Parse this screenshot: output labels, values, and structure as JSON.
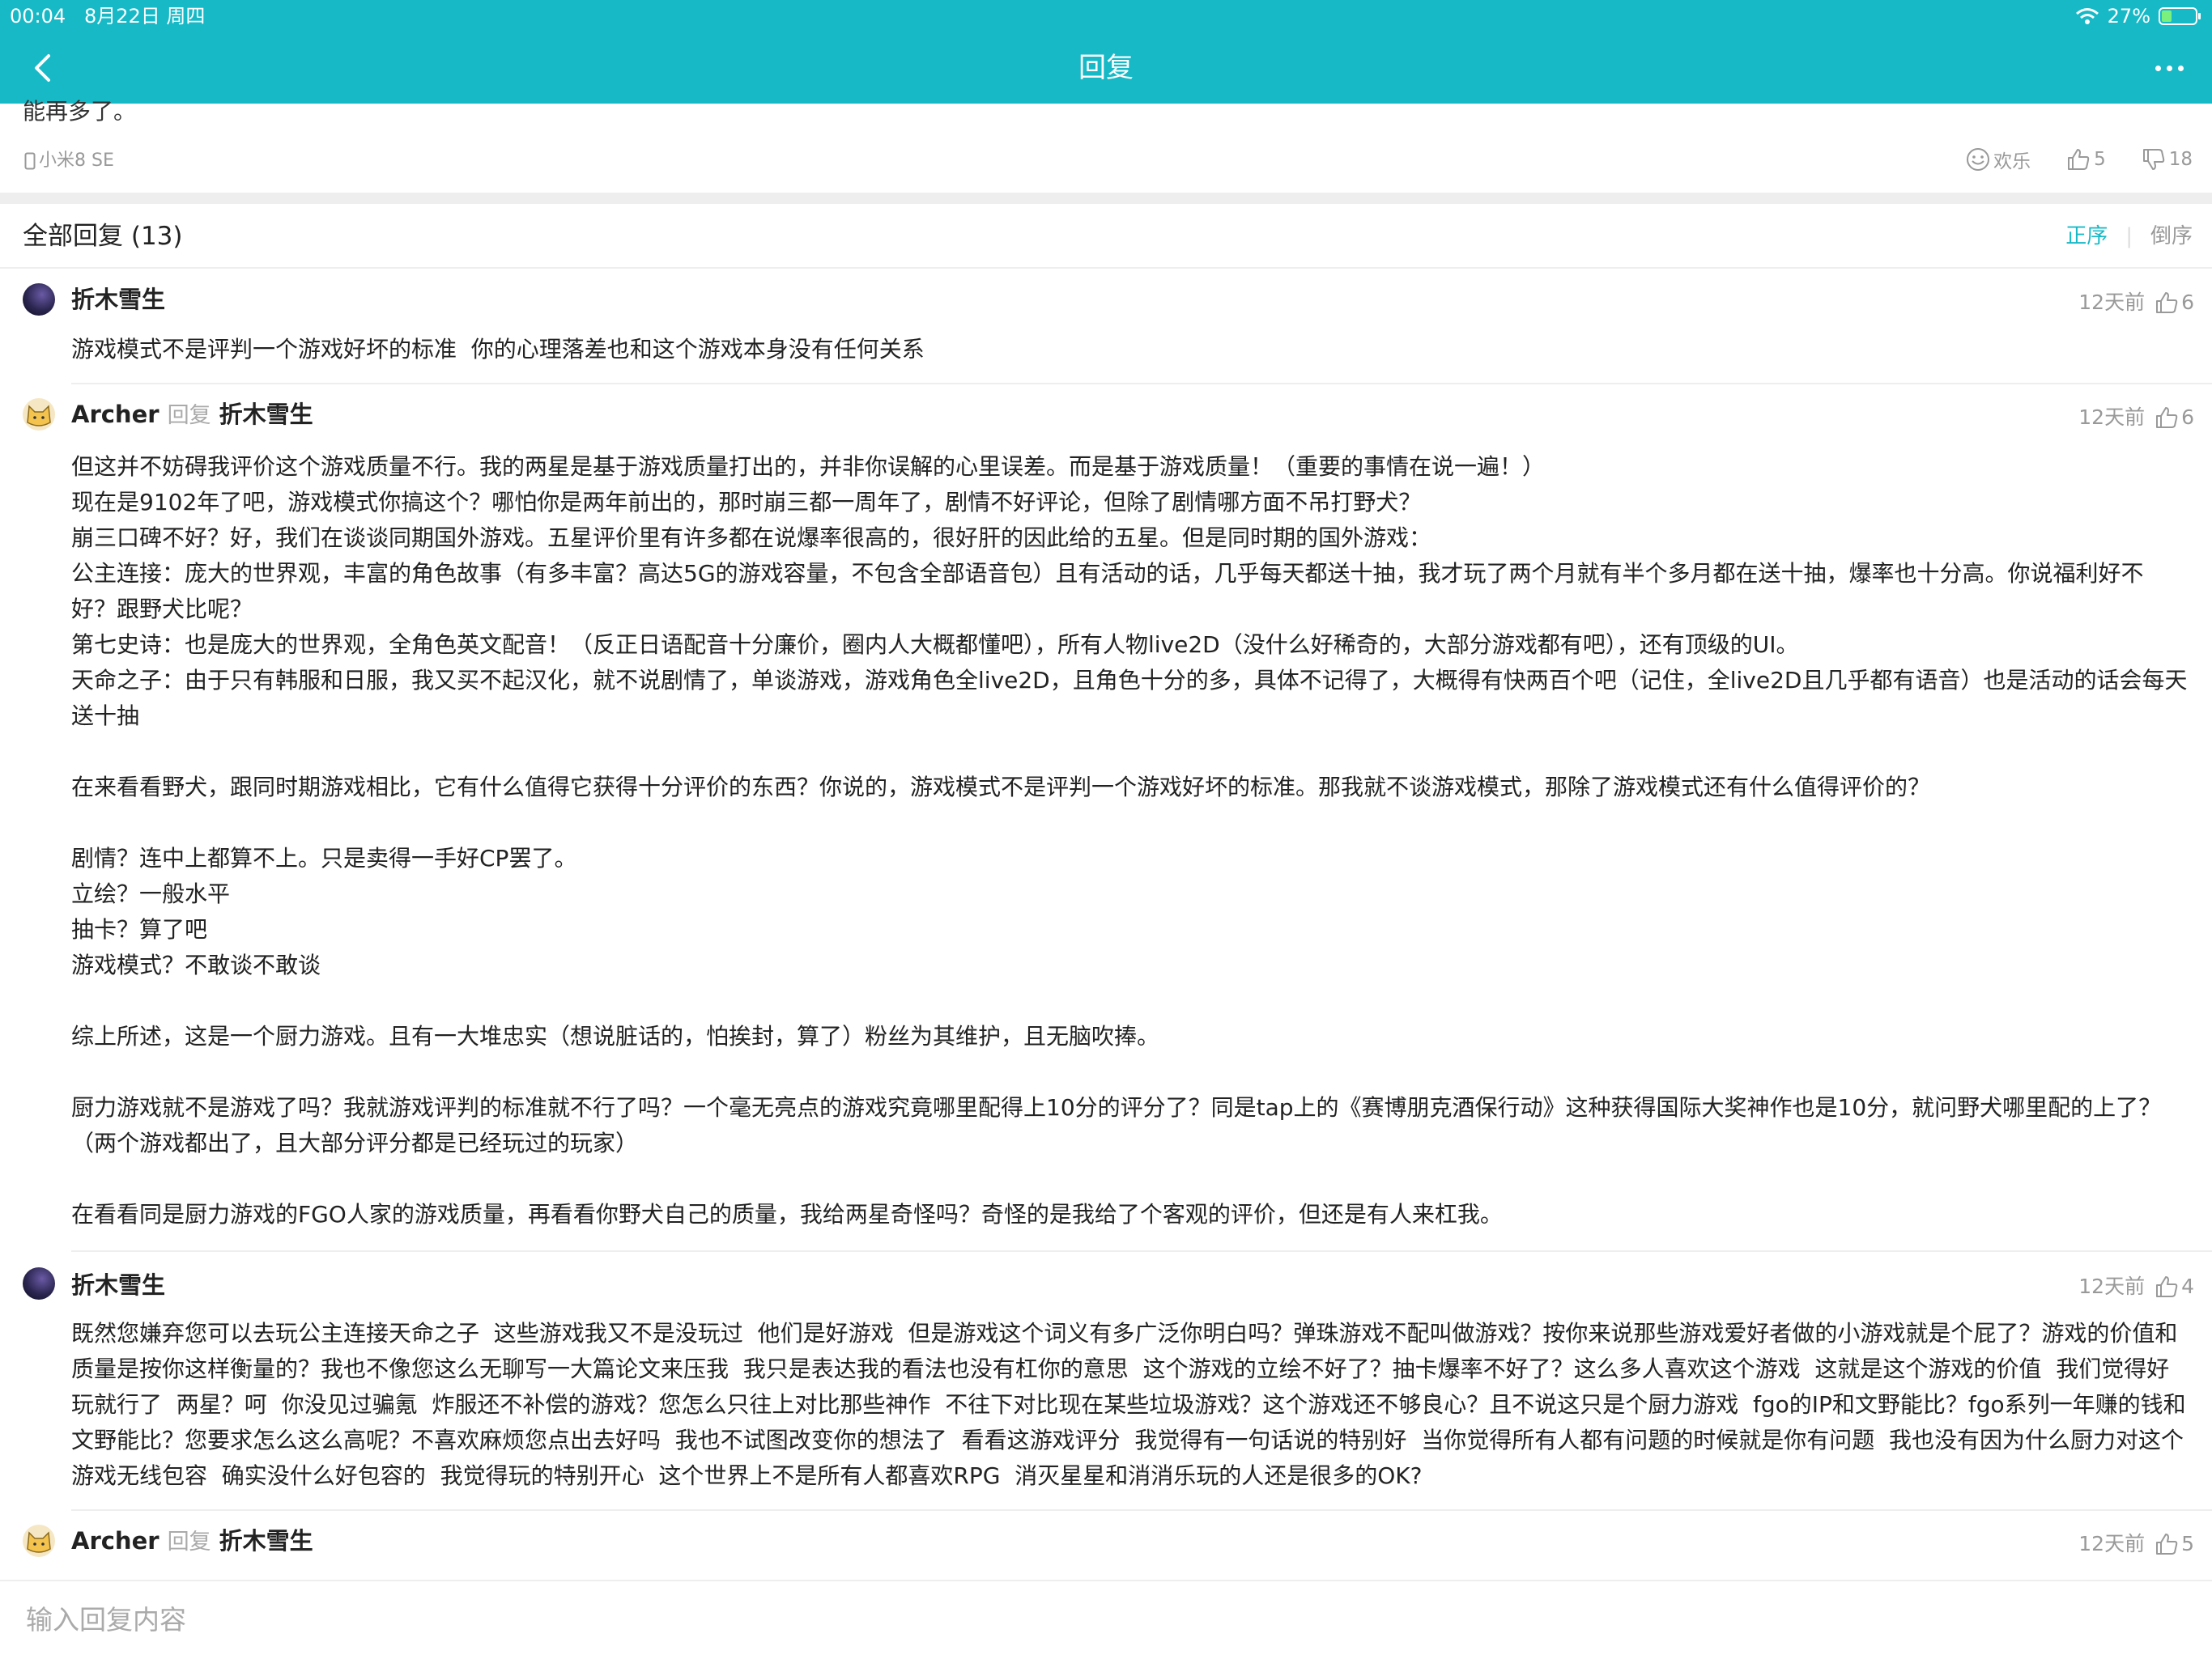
{
  "status_bar": {
    "time": "00:04",
    "date": "8月22日 周四",
    "battery": "27%"
  },
  "header": {
    "title": "回复",
    "accent_color": "#17b9c7"
  },
  "post": {
    "clipped_text": "能再多了。",
    "device": "小米8 SE",
    "mood_label": "欢乐",
    "likes": "5",
    "dislikes": "18"
  },
  "replies_section": {
    "title": "全部回复 (13)",
    "sort_asc": "正序",
    "sort_desc": "倒序"
  },
  "replies": [
    {
      "user": "折木雪生",
      "time": "12天前",
      "likes": "6",
      "text": "游戏模式不是评判一个游戏好坏的标准  你的心理落差也和这个游戏本身没有任何关系"
    },
    {
      "user": "Archer",
      "reply_word": "回复",
      "reply_to": "折木雪生",
      "time": "12天前",
      "likes": "6",
      "text": "但这并不妨碍我评价这个游戏质量不行。我的两星是基于游戏质量打出的，并非你误解的心里误差。而是基于游戏质量！（重要的事情在说一遍！）\n现在是9102年了吧，游戏模式你搞这个？哪怕你是两年前出的，那时崩三都一周年了，剧情不好评论，但除了剧情哪方面不吊打野犬？\n崩三口碑不好？好，我们在谈谈同期国外游戏。五星评价里有许多都在说爆率很高的，很好肝的因此给的五星。但是同时期的国外游戏：\n公主连接：庞大的世界观，丰富的角色故事（有多丰富？高达5G的游戏容量，不包含全部语音包）且有活动的话，几乎每天都送十抽，我才玩了两个月就有半个多月都在送十抽，爆率也十分高。你说福利好不好？跟野犬比呢？\n第七史诗：也是庞大的世界观，全角色英文配音！（反正日语配音十分廉价，圈内人大概都懂吧），所有人物live2D（没什么好稀奇的，大部分游戏都有吧），还有顶级的UI。\n天命之子：由于只有韩服和日服，我又买不起汉化，就不说剧情了，单谈游戏，游戏角色全live2D，且角色十分的多，具体不记得了，大概得有快两百个吧（记住，全live2D且几乎都有语音）也是活动的话会每天送十抽\n\n在来看看野犬，跟同时期游戏相比，它有什么值得它获得十分评价的东西？你说的，游戏模式不是评判一个游戏好坏的标准。那我就不谈游戏模式，那除了游戏模式还有什么值得评价的？\n\n剧情？连中上都算不上。只是卖得一手好CP罢了。\n立绘？一般水平\n抽卡？算了吧\n游戏模式？不敢谈不敢谈\n\n综上所述，这是一个厨力游戏。且有一大堆忠实（想说脏话的，怕挨封，算了）粉丝为其维护，且无脑吹捧。\n\n厨力游戏就不是游戏了吗？我就游戏评判的标准就不行了吗？一个毫无亮点的游戏究竟哪里配得上10分的评分了？同是tap上的《赛博朋克酒保行动》这种获得国际大奖神作也是10分，就问野犬哪里配的上了？（两个游戏都出了，且大部分评分都是已经玩过的玩家）\n\n在看看同是厨力游戏的FGO人家的游戏质量，再看看你野犬自己的质量，我给两星奇怪吗？奇怪的是我给了个客观的评价，但还是有人来杠我。"
    },
    {
      "user": "折木雪生",
      "time": "12天前",
      "likes": "4",
      "text": "既然您嫌弃您可以去玩公主连接天命之子  这些游戏我又不是没玩过  他们是好游戏  但是游戏这个词义有多广泛你明白吗？弹珠游戏不配叫做游戏？按你来说那些游戏爱好者做的小游戏就是个屁了？游戏的价值和质量是按你这样衡量的？我也不像您这么无聊写一大篇论文来压我  我只是表达我的看法也没有杠你的意思  这个游戏的立绘不好了？抽卡爆率不好了？这么多人喜欢这个游戏  这就是这个游戏的价值  我们觉得好玩就行了  两星？呵  你没见过骗氪  炸服还不补偿的游戏？您怎么只往上对比那些神作  不往下对比现在某些垃圾游戏？这个游戏还不够良心？且不说这只是个厨力游戏  fgo的IP和文野能比？fgo系列一年赚的钱和文野能比？您要求怎么这么高呢？不喜欢麻烦您点出去好吗  我也不试图改变你的想法了  看看这游戏评分  我觉得有一句话说的特别好  当你觉得所有人都有问题的时候就是你有问题  我也没有因为什么厨力对这个游戏无线包容  确实没什么好包容的  我觉得玩的特别开心  这个世界上不是所有人都喜欢RPG  消灭星星和消消乐玩的人还是很多的OK?"
    },
    {
      "user": "Archer",
      "reply_word": "回复",
      "reply_to": "折木雪生",
      "time": "12天前",
      "likes": "5"
    }
  ],
  "reply_input": {
    "placeholder": "输入回复内容",
    "value": ""
  }
}
